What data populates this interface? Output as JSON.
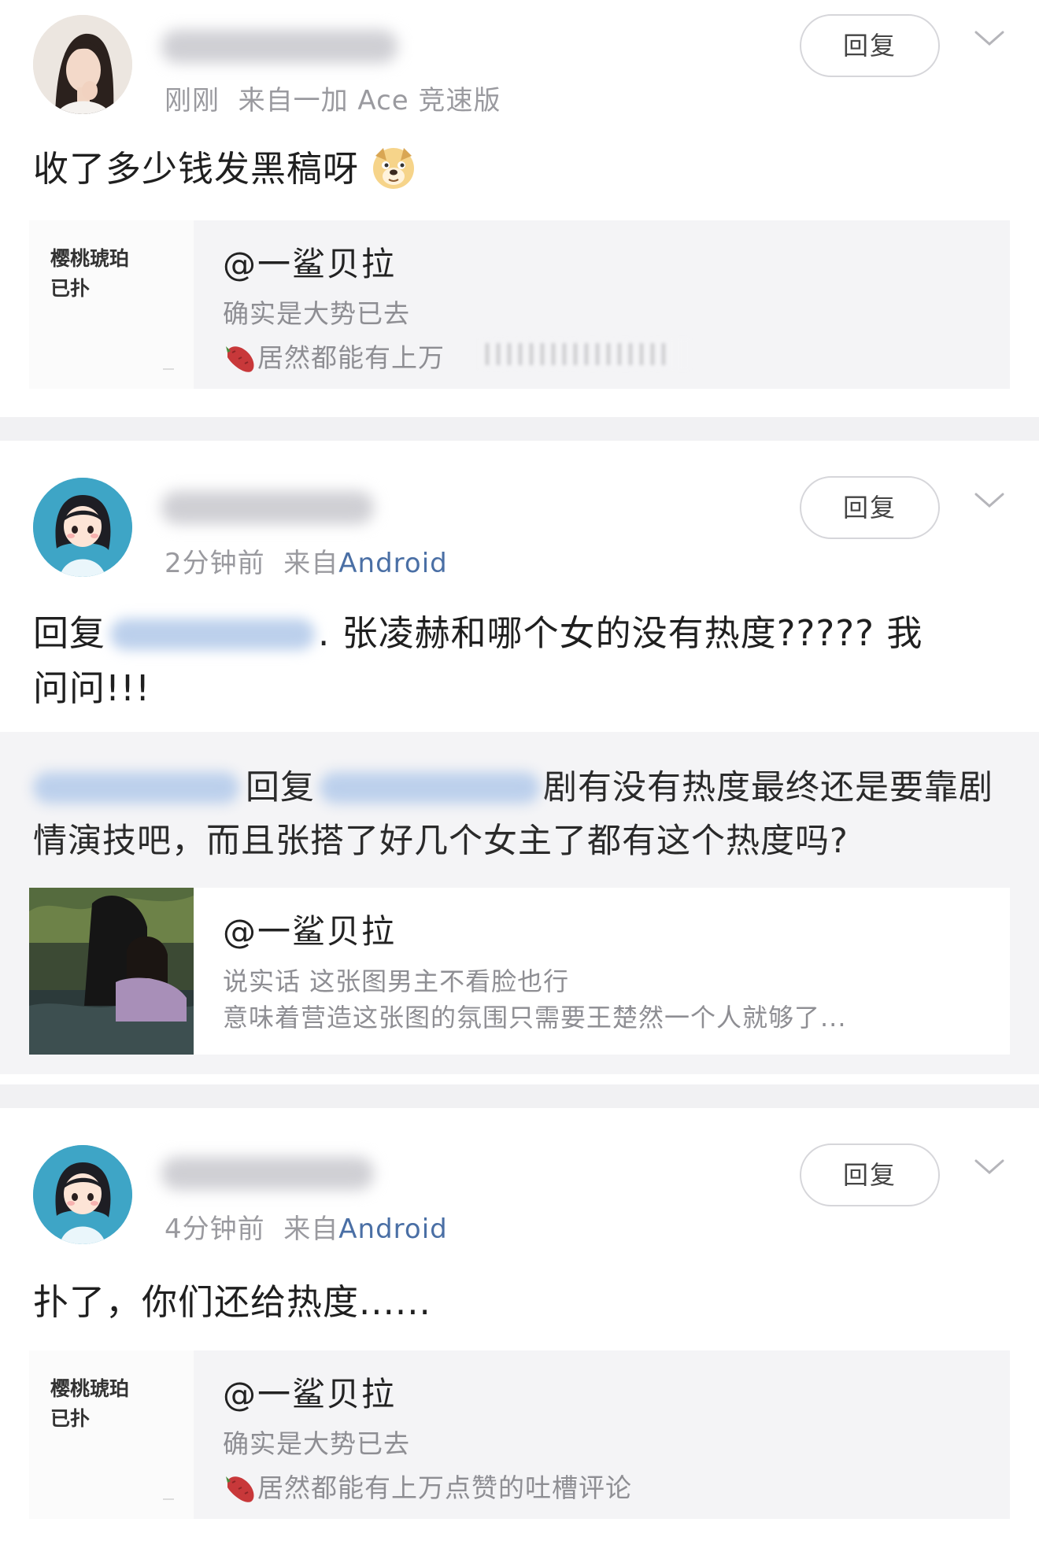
{
  "comments": [
    {
      "time": "刚刚",
      "source_prefix": "来自",
      "source": "一加 Ace 竞速版",
      "reply_label": "回复",
      "text": "收了多少钱发黑稿呀",
      "emoji": "doge-emoji",
      "quote": {
        "thumb_text": "樱桃琥珀\n已扑",
        "author": "@一鲨贝拉",
        "line1": "确实是大势已去",
        "line2": "居然都能有上万"
      }
    },
    {
      "time": "2分钟前",
      "source_prefix": "来自",
      "source": "Android",
      "reply_label": "回复",
      "reply_prefix": "回复",
      "text_line1": ". 张凌赫和哪个女的没有热度????? 我",
      "text_line2": "问问!!!",
      "sub": {
        "reply_word": "回复",
        "line1_rest": "剧有没有热度最终还是要靠剧",
        "line2": "情演技吧，而且张搭了好几个女主了都有这个热度吗?"
      },
      "quote": {
        "author": "@一鲨贝拉",
        "line1": "说实话 这张图男主不看脸也行",
        "line2": "意味着营造这张图的氛围只需要王楚然一个人就够了..."
      }
    },
    {
      "time": "4分钟前",
      "source_prefix": "来自",
      "source": "Android",
      "reply_label": "回复",
      "text": "扑了，你们还给热度......",
      "quote": {
        "thumb_text": "樱桃琥珀\n已扑",
        "author": "@一鲨贝拉",
        "line1": "确实是大势已去",
        "line2": "居然都能有上万点赞的吐槽评论"
      }
    }
  ],
  "colors": {
    "link_blue": "#4a6fa5",
    "meta_gray": "#9a9a9f",
    "card_bg": "#f4f4f6",
    "divider": "#f1f1f3"
  }
}
